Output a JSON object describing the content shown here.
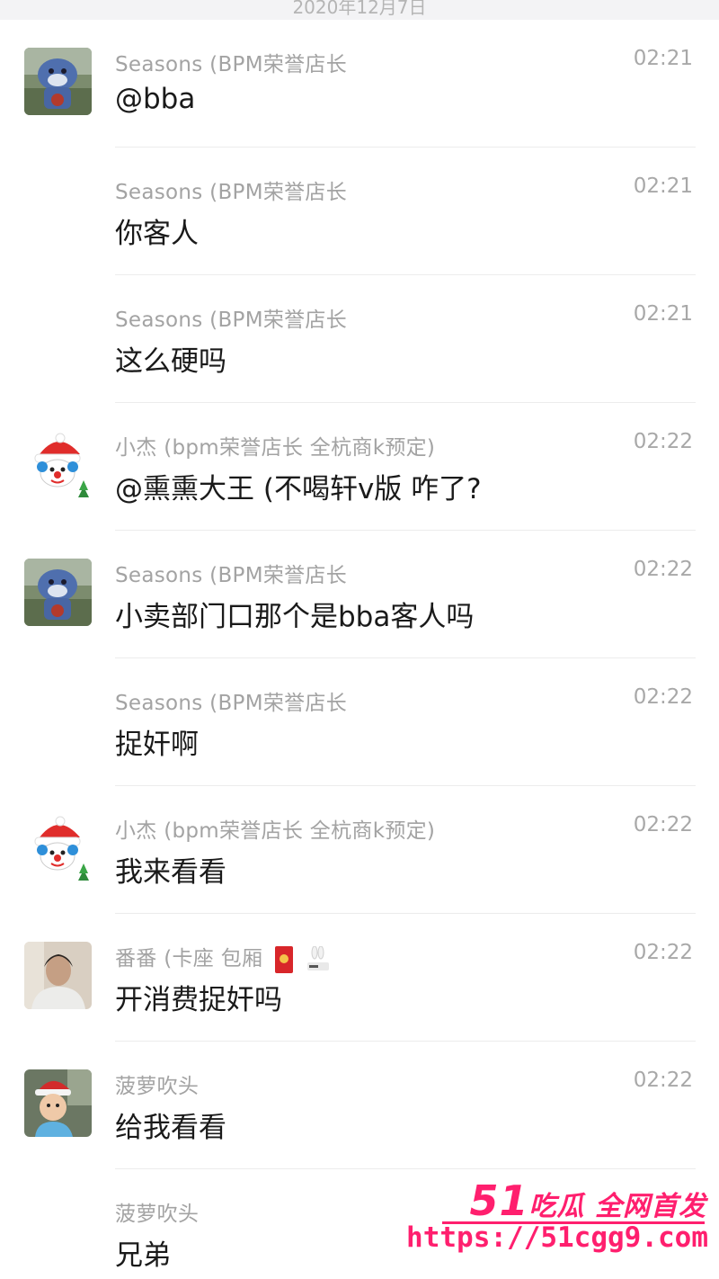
{
  "date_header": "2020年12月7日",
  "messages": [
    {
      "sender": "Seasons (BPM荣誉店长",
      "time": "02:21",
      "text": "@bba",
      "avatar": "blue-mascot"
    },
    {
      "sender": "Seasons (BPM荣誉店长",
      "time": "02:21",
      "text": "你客人",
      "avatar": null
    },
    {
      "sender": "Seasons (BPM荣誉店长",
      "time": "02:21",
      "text": "这么硬吗",
      "avatar": null
    },
    {
      "sender": "小杰 (bpm荣誉店长 全杭商k预定)",
      "time": "02:22",
      "text": "@熏熏大王 (不喝轩v版 咋了?",
      "avatar": "santa-clown"
    },
    {
      "sender": "Seasons (BPM荣誉店长",
      "time": "02:22",
      "text": "小卖部门口那个是bba客人吗",
      "avatar": "blue-mascot"
    },
    {
      "sender": "Seasons (BPM荣誉店长",
      "time": "02:22",
      "text": "捉奸啊",
      "avatar": null
    },
    {
      "sender": "小杰 (bpm荣誉店长 全杭商k预定)",
      "time": "02:22",
      "text": "我来看看",
      "avatar": "santa-clown"
    },
    {
      "sender": "番番 (卡座 包厢",
      "time": "02:22",
      "text": "开消费捉奸吗",
      "avatar": "person-photo",
      "badges": [
        "red-envelope-icon",
        "bunny-icon"
      ]
    },
    {
      "sender": "菠萝吹头",
      "time": "02:22",
      "text": "给我看看",
      "avatar": "child-santa-photo"
    },
    {
      "sender": "菠萝吹头",
      "time": "",
      "text": "兄弟",
      "avatar": null
    }
  ],
  "watermark": {
    "top": "51吃瓜 全网首发",
    "top_num": "51",
    "top_rest": "吃瓜 全网首发",
    "url": "https://51cgg9.com",
    "color": "#ff1f6e"
  }
}
